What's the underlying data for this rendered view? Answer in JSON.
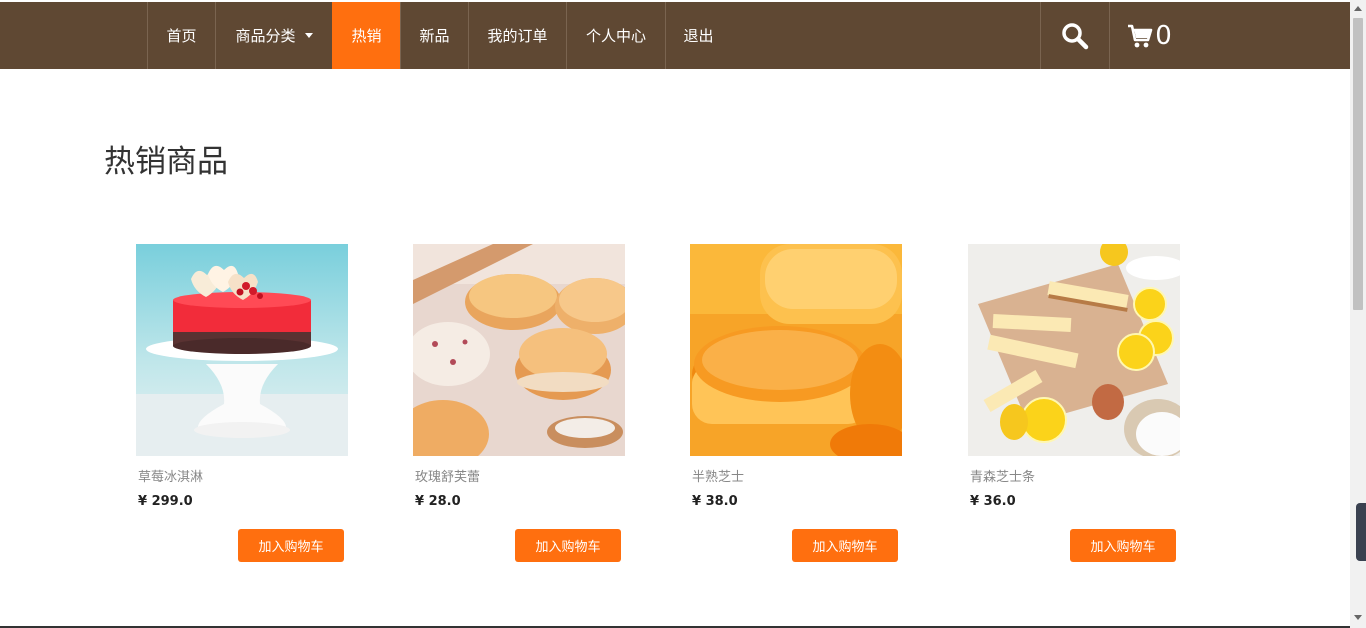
{
  "nav": {
    "items": [
      {
        "label": "首页"
      },
      {
        "label": "商品分类"
      },
      {
        "label": "热销"
      },
      {
        "label": "新品"
      },
      {
        "label": "我的订单"
      },
      {
        "label": "个人中心"
      },
      {
        "label": "退出"
      }
    ],
    "cart_count": "0"
  },
  "main": {
    "title": "热销商品",
    "add_to_cart_label": "加入购物车",
    "products": [
      {
        "name": "草莓冰淇淋",
        "price": "¥ 299.0"
      },
      {
        "name": "玫瑰舒芙蕾",
        "price": "¥ 28.0"
      },
      {
        "name": "半熟芝士",
        "price": "¥ 38.0"
      },
      {
        "name": "青森芝士条",
        "price": "¥ 36.0"
      }
    ]
  },
  "colors": {
    "navbar": "#5f4833",
    "accent": "#ff6f0f"
  }
}
